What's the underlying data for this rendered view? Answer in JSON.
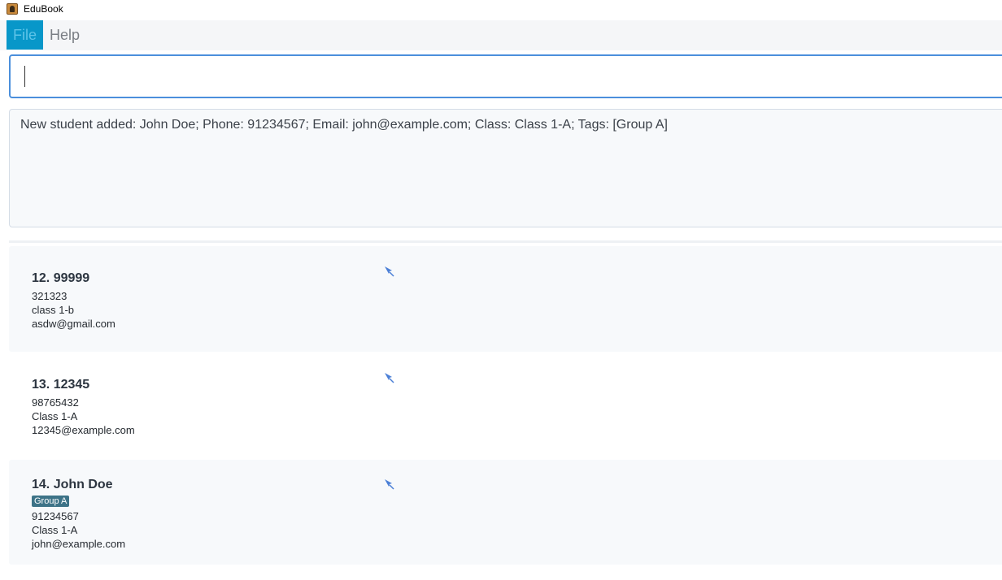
{
  "window": {
    "title": "EduBook"
  },
  "menu": {
    "file_label": "File",
    "help_label": "Help"
  },
  "command": {
    "value": ""
  },
  "result": {
    "message": "New student added: John Doe; Phone: 91234567; Email: john@example.com; Class: Class 1-A; Tags: [Group A]"
  },
  "students": [
    {
      "index_name": "12. 99999",
      "phone": "321323",
      "class": "class 1-b",
      "email": "asdw@gmail.com",
      "tags": []
    },
    {
      "index_name": "13. 12345",
      "phone": "98765432",
      "class": "Class 1-A",
      "email": "12345@example.com",
      "tags": []
    },
    {
      "index_name": "14. John Doe",
      "tags": [
        "Group A"
      ],
      "phone": "91234567",
      "class": "Class 1-A",
      "email": "john@example.com"
    }
  ],
  "icons": {
    "app": "address-book-icon",
    "pin": "pin-icon"
  },
  "colors": {
    "accent": "#0897c9",
    "focus_border": "#4b8fdc",
    "tag_bg": "#3d7387",
    "pin": "#4b7fd6"
  }
}
